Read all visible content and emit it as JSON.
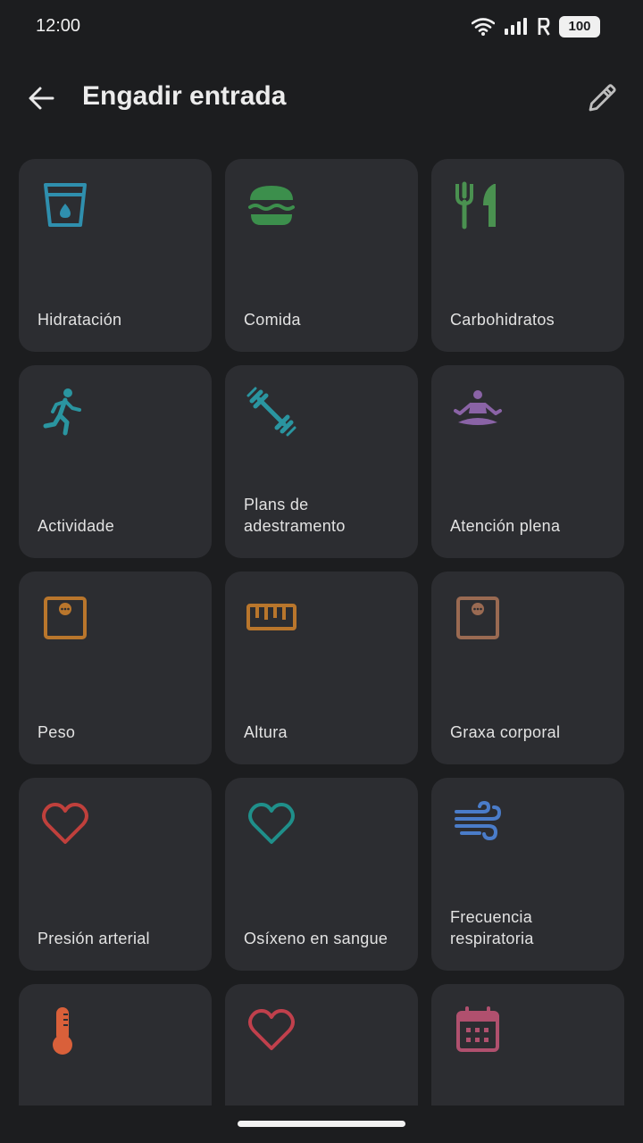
{
  "status_bar": {
    "time": "12:00",
    "battery": "100",
    "icons": [
      "wifi-icon",
      "signal-icon",
      "roaming-icon",
      "battery-icon"
    ]
  },
  "app_bar": {
    "title": "Engadir entrada",
    "back_icon": "arrow-back-icon",
    "edit_icon": "pencil-icon"
  },
  "tiles": [
    {
      "label": "Hidratación",
      "icon": "glass-water-icon",
      "color": "#2f8fae"
    },
    {
      "label": "Comida",
      "icon": "burger-icon",
      "color": "#3c8f4c"
    },
    {
      "label": "Carbohidratos",
      "icon": "fork-knife-icon",
      "color": "#4a9150"
    },
    {
      "label": "Actividade",
      "icon": "running-icon",
      "color": "#2a95a0"
    },
    {
      "label": "Plans de adestramento",
      "icon": "dumbbell-icon",
      "color": "#2a95a0"
    },
    {
      "label": "Atención plena",
      "icon": "meditation-icon",
      "color": "#8a63a6"
    },
    {
      "label": "Peso",
      "icon": "scale-icon",
      "color": "#b9762c"
    },
    {
      "label": "Altura",
      "icon": "ruler-icon",
      "color": "#b9762c"
    },
    {
      "label": "Graxa corporal",
      "icon": "scale-icon",
      "color": "#9a6a52"
    },
    {
      "label": "Presión arterial",
      "icon": "heart-icon",
      "color": "#c0403c"
    },
    {
      "label": "Osíxeno en sangue",
      "icon": "heart-icon",
      "color": "#1f8f8a"
    },
    {
      "label": "Frecuencia respiratoria",
      "icon": "wind-icon",
      "color": "#4a7cc9"
    },
    {
      "label": "",
      "icon": "thermometer-icon",
      "color": "#d9603a"
    },
    {
      "label": "",
      "icon": "heart-icon",
      "color": "#c0404c"
    },
    {
      "label": "",
      "icon": "calendar-icon",
      "color": "#b0506e"
    }
  ]
}
